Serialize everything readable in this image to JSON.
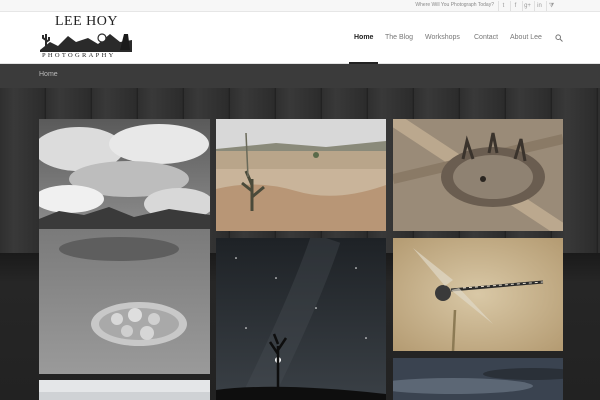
{
  "topbar": {
    "tagline": "Where Will You Photograph Today?",
    "social": [
      "twitter-icon",
      "facebook-icon",
      "google-plus-icon",
      "linkedin-icon",
      "rss-icon"
    ]
  },
  "logo": {
    "name": "LEE HOY",
    "sub": "PHOTOGRAPHY"
  },
  "nav": [
    {
      "label": "Home",
      "active": true
    },
    {
      "label": "The Blog"
    },
    {
      "label": "Workshops"
    },
    {
      "label": "Contact"
    },
    {
      "label": "About Lee"
    }
  ],
  "breadcrumb": {
    "label": "Home"
  },
  "gallery": [
    {
      "name": "desert-cactus-bw"
    },
    {
      "name": "cholla-grassland"
    },
    {
      "name": "horned-lizard"
    },
    {
      "name": "dragonfly"
    },
    {
      "name": "milky-way-agave"
    },
    {
      "name": "storm-sky"
    },
    {
      "name": "bottom-left-tile"
    }
  ],
  "colors": {
    "accent": "#222222",
    "header_bg": "#ffffff",
    "breadcrumb_bg": "#3b3b3b"
  }
}
